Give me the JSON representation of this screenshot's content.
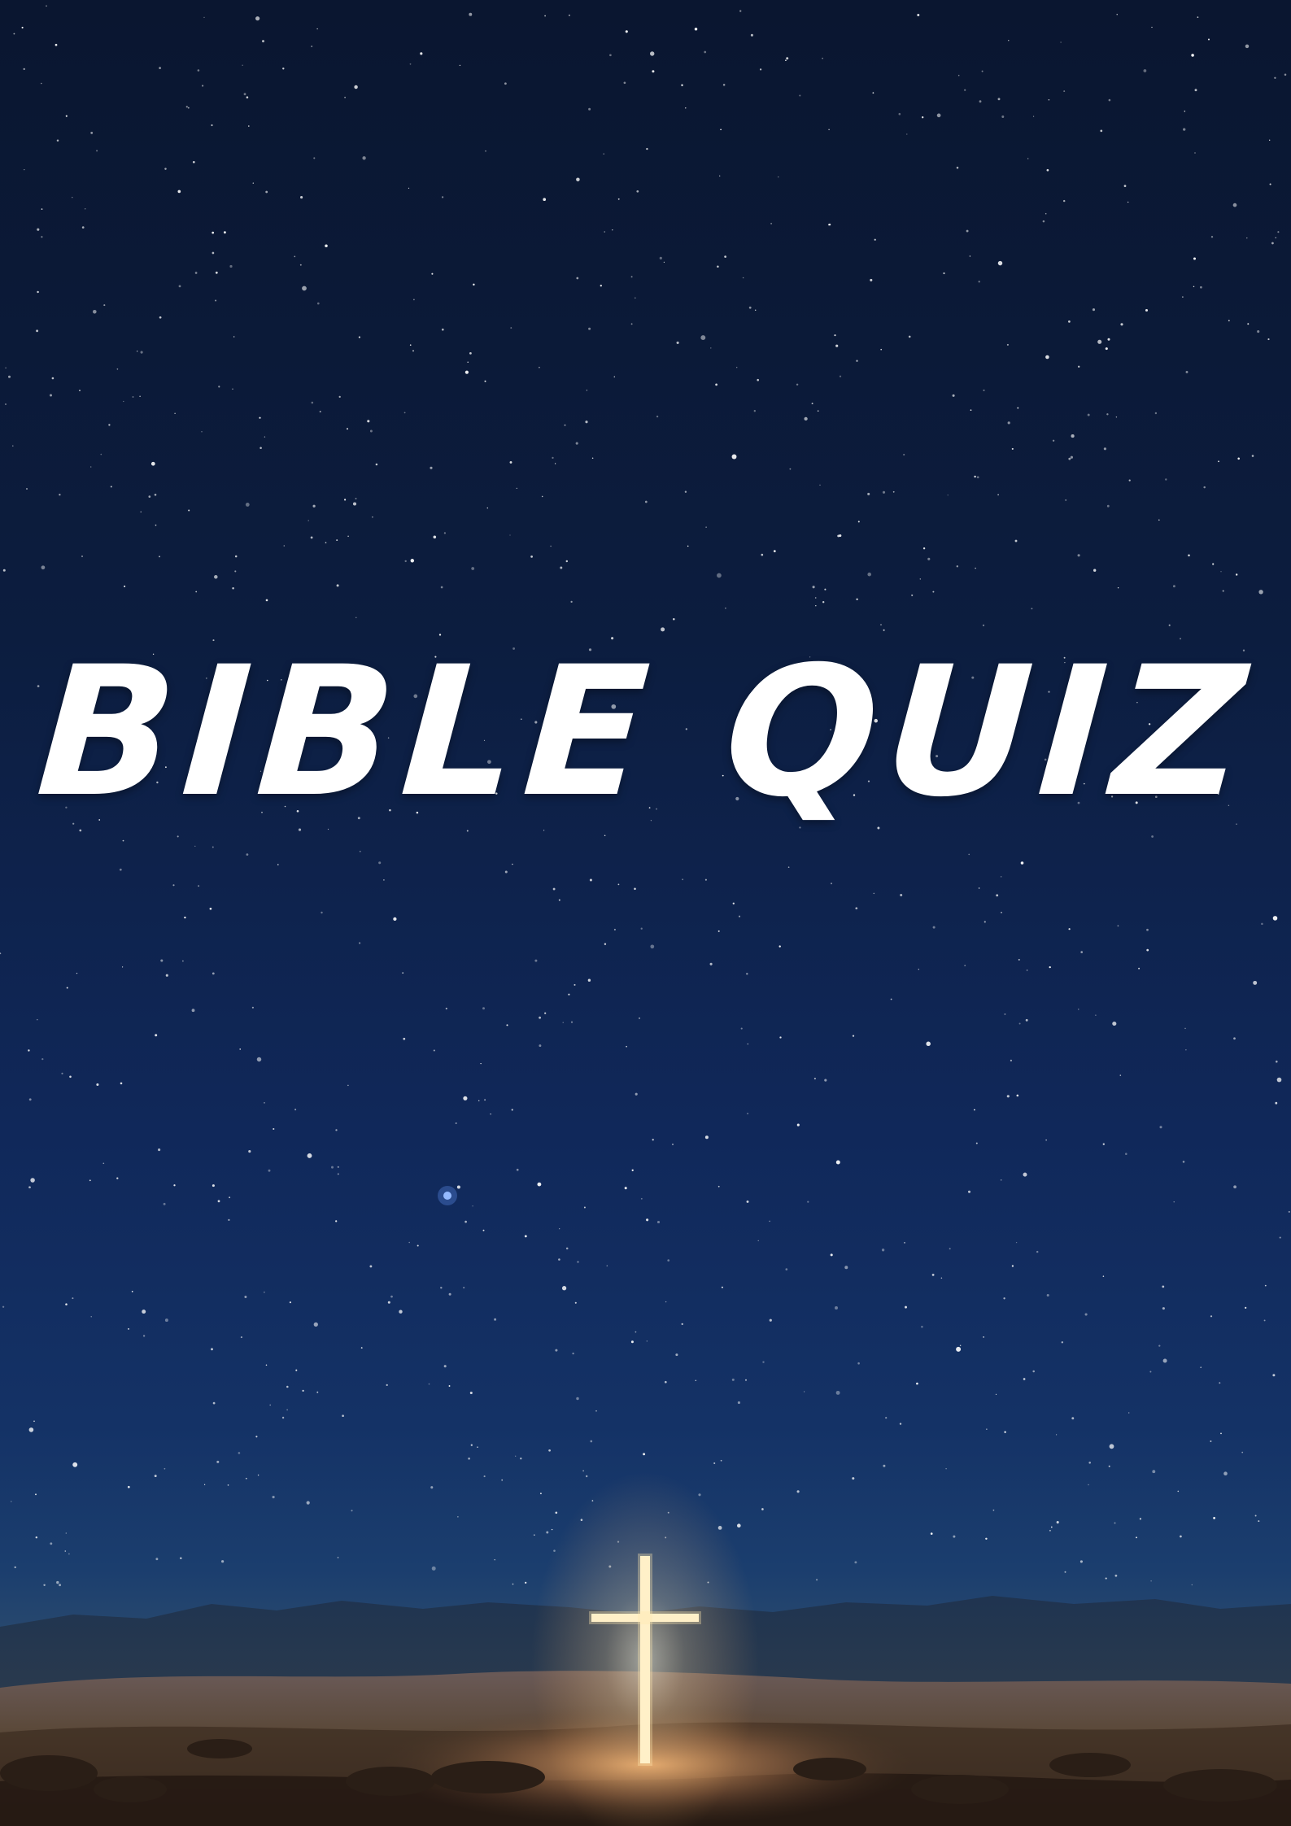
{
  "title": "BIBLE QUIZ",
  "colors": {
    "sky_top": "#0a1630",
    "sky_mid": "#10285a",
    "horizon": "#2a4a6e",
    "sand": "#6a5240",
    "cross_glow": "#fff2cc",
    "title_text": "#ffffff"
  },
  "icons": {
    "cross": "glowing-cross-icon"
  }
}
